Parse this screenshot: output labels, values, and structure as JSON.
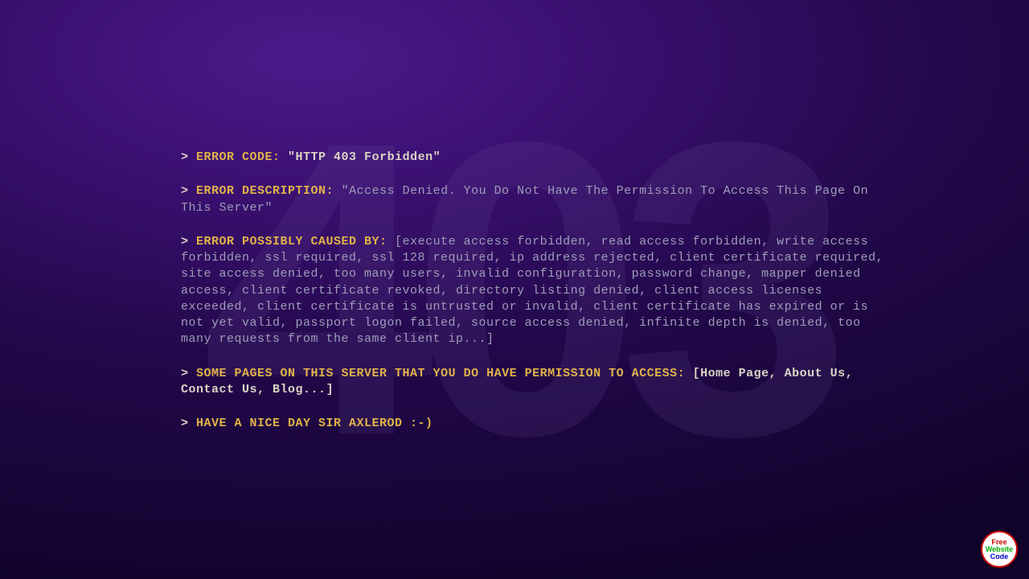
{
  "background_number": "403",
  "error_code": {
    "label": "ERROR CODE",
    "value": "\"HTTP 403 Forbidden\""
  },
  "error_description": {
    "label": "ERROR DESCRIPTION",
    "value": "\"Access Denied. You Do Not Have The Permission To Access This Page On This Server\""
  },
  "error_causes": {
    "label": "ERROR POSSIBLY CAUSED BY",
    "value": "[execute access forbidden, read access forbidden, write access forbidden, ssl required, ssl 128 required, ip address rejected, client certificate required, site access denied, too many users, invalid configuration, password change, mapper denied access, client certificate revoked, directory listing denied, client access licenses exceeded, client certificate is untrusted or invalid, client certificate has expired or is not yet valid, passport logon failed, source access denied, infinite depth is denied, too many requests from the same client ip...]"
  },
  "allowed_pages": {
    "label": "SOME PAGES ON THIS SERVER THAT YOU DO HAVE PERMISSION TO ACCESS",
    "links": [
      "Home Page",
      "About Us",
      "Contact Us",
      "Blog"
    ],
    "trailer": "..."
  },
  "farewell": {
    "label": "HAVE A NICE DAY SIR AXLEROD :-)"
  },
  "badge": {
    "l1": "Free",
    "l2": "Website",
    "l3": "Code"
  }
}
